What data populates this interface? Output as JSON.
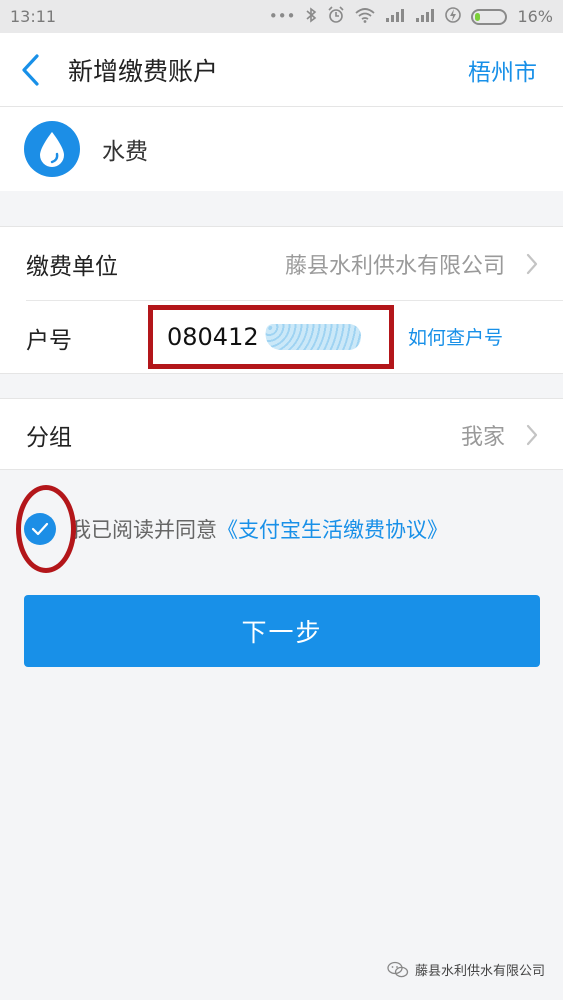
{
  "status_bar": {
    "time": "13:11",
    "battery_percent_label": "16%",
    "battery_level": 0.16,
    "icons": [
      "dots-icon",
      "bluetooth-icon",
      "alarm-icon",
      "wifi-icon",
      "signal-icon",
      "signal-icon",
      "charging-icon",
      "battery-icon"
    ]
  },
  "navbar": {
    "title": "新增缴费账户",
    "city": "梧州市"
  },
  "service": {
    "name": "水费",
    "icon": "water-drop-icon"
  },
  "form": {
    "unit_label": "缴费单位",
    "unit_value": "藤县水利供水有限公司",
    "account_label": "户号",
    "account_value": "080412",
    "account_help": "如何查户号",
    "group_label": "分组",
    "group_value": "我家"
  },
  "agreement": {
    "text": "我已阅读并同意",
    "link": "《支付宝生活缴费协议》",
    "checked": true
  },
  "next_button": {
    "label": "下一步"
  },
  "watermark": {
    "text": "藤县水利供水有限公司"
  },
  "colors": {
    "accent": "#1890e8",
    "annotation_red": "#b3161a",
    "background": "#f4f5f7"
  }
}
